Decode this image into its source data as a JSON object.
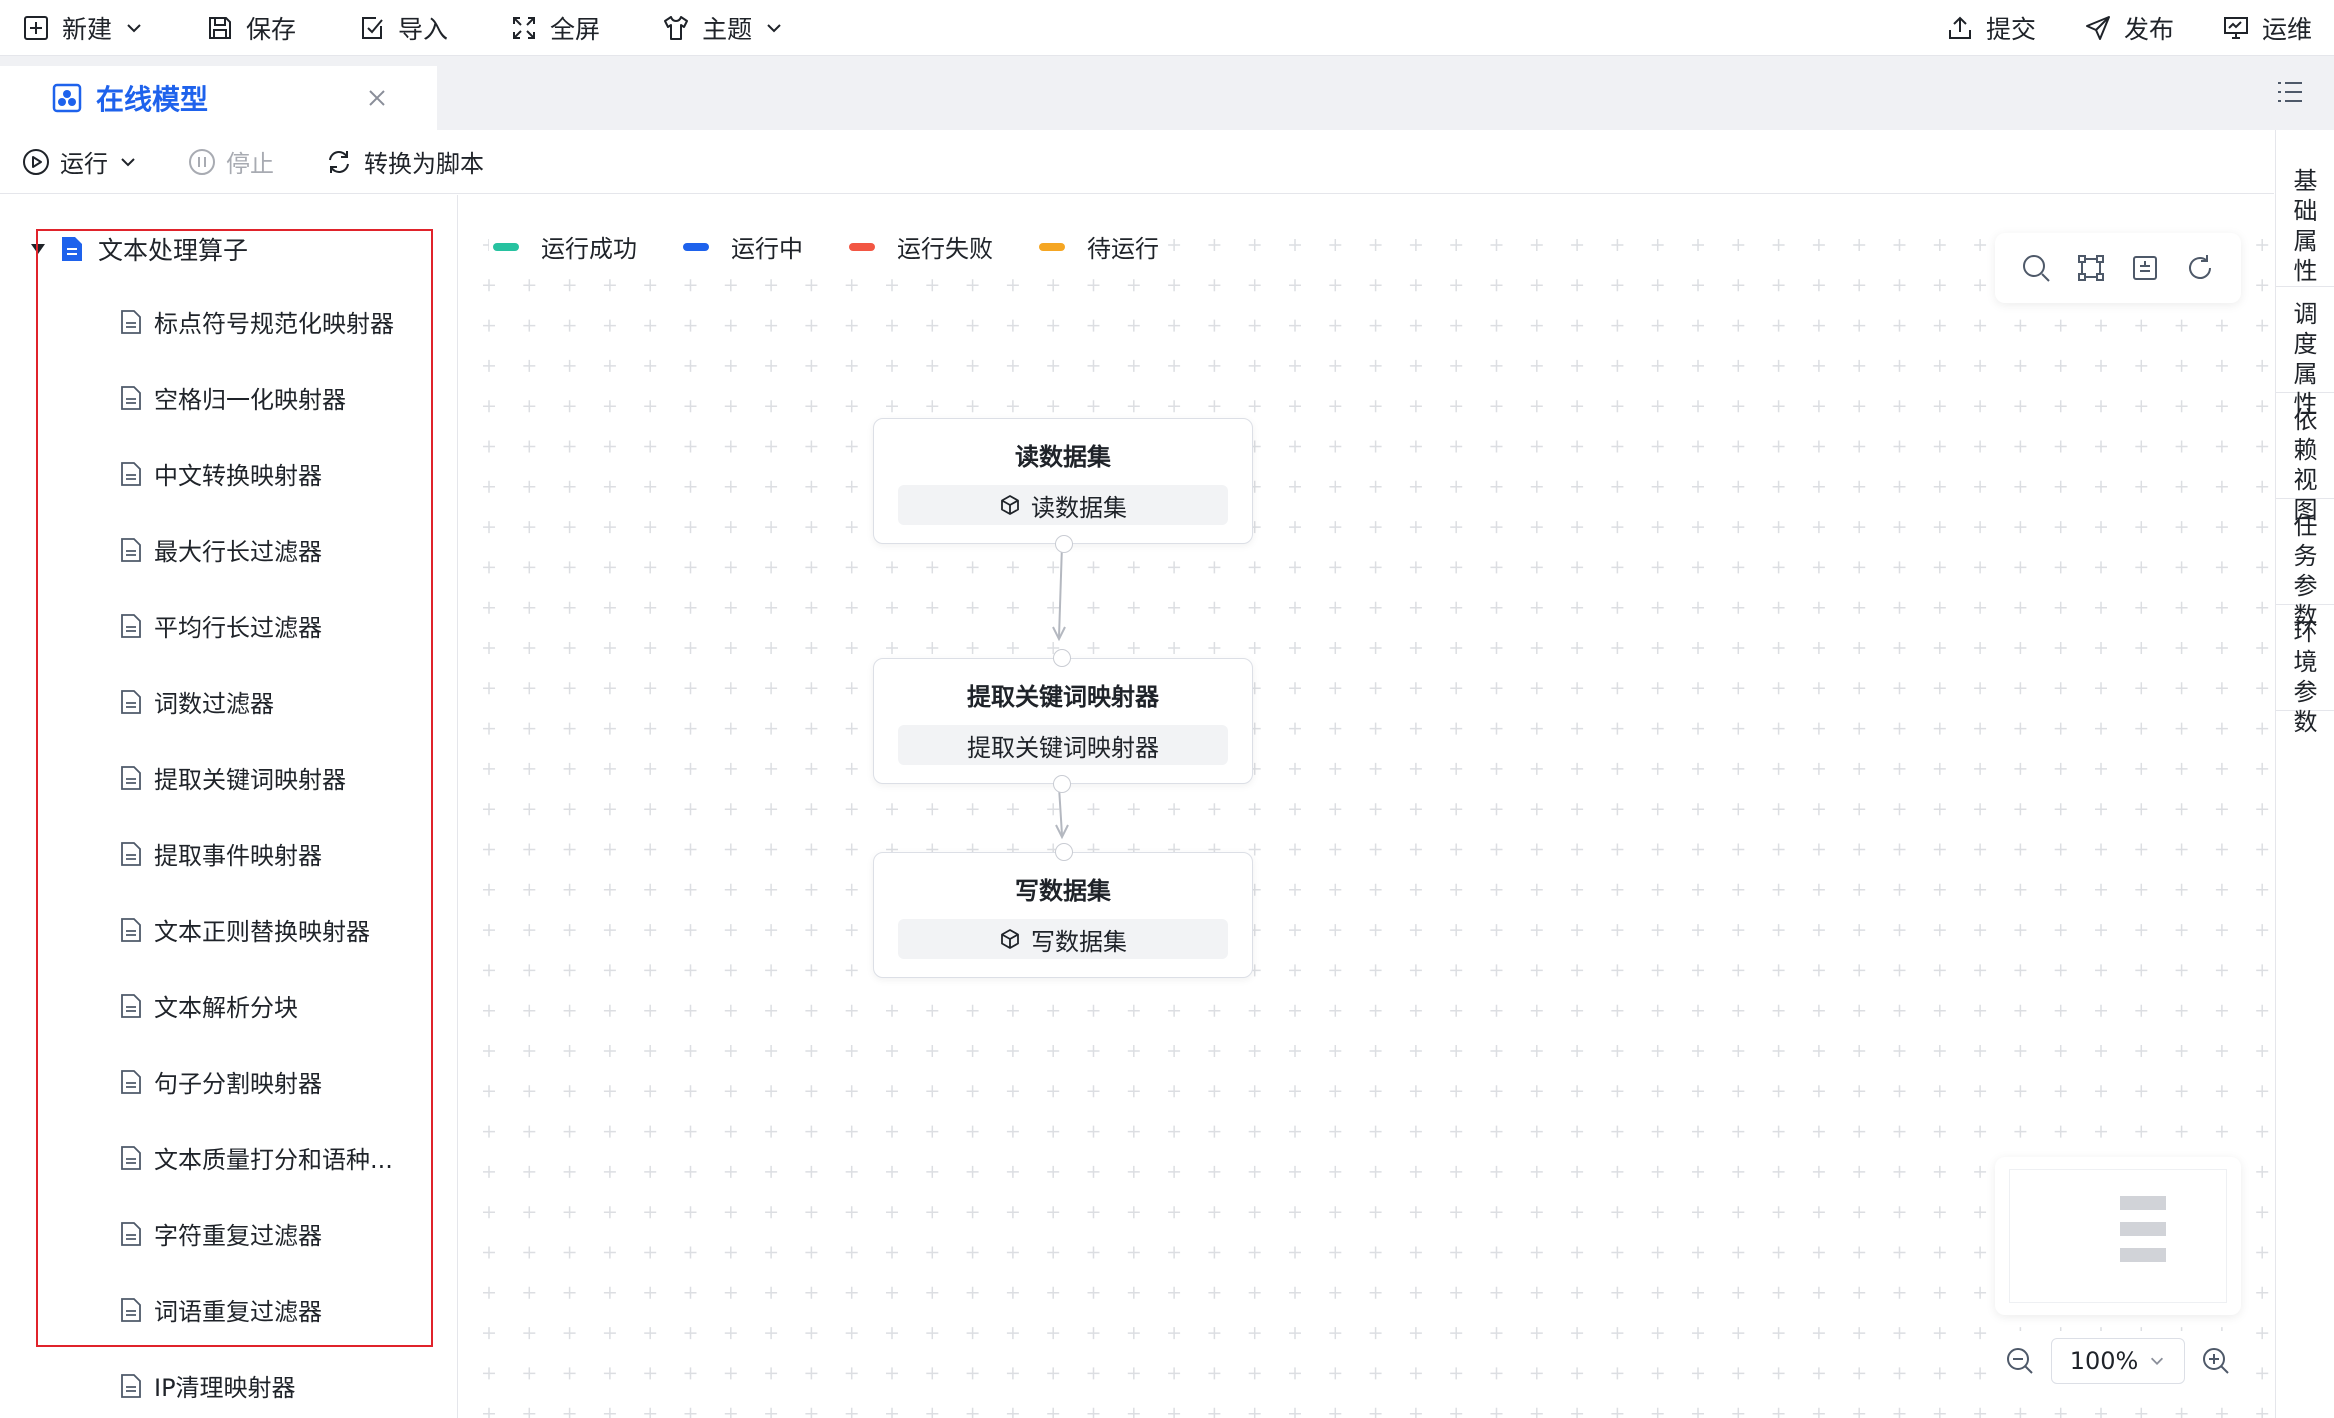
{
  "toolbar": {
    "left": [
      {
        "label": "新建",
        "icon": "plus-square-icon",
        "dropdown": true
      },
      {
        "label": "保存",
        "icon": "save-icon"
      },
      {
        "label": "导入",
        "icon": "import-icon"
      },
      {
        "label": "全屏",
        "icon": "fullscreen-icon"
      },
      {
        "label": "主题",
        "icon": "shirt-icon",
        "dropdown": true
      }
    ],
    "right": [
      {
        "label": "提交",
        "icon": "upload-icon"
      },
      {
        "label": "发布",
        "icon": "send-icon"
      },
      {
        "label": "运维",
        "icon": "monitor-icon"
      }
    ]
  },
  "tab": {
    "label": "在线模型",
    "icon": "model-icon"
  },
  "runbar": {
    "run": "运行",
    "stop": "停止",
    "convert": "转换为脚本"
  },
  "tree": {
    "root": "文本处理算子",
    "items": [
      "标点符号规范化映射器",
      "空格归一化映射器",
      "中文转换映射器",
      "最大行长过滤器",
      "平均行长过滤器",
      "词数过滤器",
      "提取关键词映射器",
      "提取事件映射器",
      "文本正则替换映射器",
      "文本解析分块",
      "句子分割映射器",
      "文本质量打分和语种...",
      "字符重复过滤器",
      "词语重复过滤器",
      "IP清理映射器"
    ]
  },
  "legend": [
    {
      "label": "运行成功",
      "color": "#27c2a0"
    },
    {
      "label": "运行中",
      "color": "#1e62ec"
    },
    {
      "label": "运行失败",
      "color": "#f25643"
    },
    {
      "label": "待运行",
      "color": "#f5a623"
    }
  ],
  "nodes": [
    {
      "title": "读数据集",
      "chip": "读数据集",
      "chip_icon": "cube-icon"
    },
    {
      "title": "提取关键词映射器",
      "chip": "提取关键词映射器",
      "chip_icon": ""
    },
    {
      "title": "写数据集",
      "chip": "写数据集",
      "chip_icon": "cube-icon"
    }
  ],
  "zoom": {
    "value": "100%"
  },
  "side_tabs": [
    {
      "chars": [
        "基",
        "础",
        "属",
        "性"
      ]
    },
    {
      "chars": [
        "调",
        "度",
        "属",
        "性"
      ]
    },
    {
      "chars": [
        "依",
        "赖",
        "视",
        "图"
      ]
    },
    {
      "chars": [
        "任",
        "务",
        "参",
        "数"
      ]
    },
    {
      "chars": [
        "环",
        "境",
        "参",
        "数"
      ]
    }
  ]
}
